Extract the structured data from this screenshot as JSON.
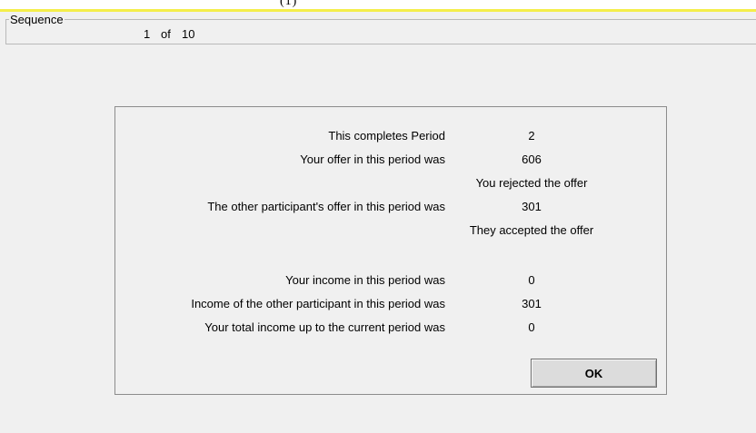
{
  "header": {
    "title_glyph": "(1)"
  },
  "sequence": {
    "label": "Sequence",
    "current": "1",
    "of_label": "of",
    "total": "10"
  },
  "results": {
    "period_label": "This completes Period",
    "period_value": "2",
    "your_offer_label": "Your offer in this period was",
    "your_offer_value": "606",
    "your_offer_status": "You rejected the offer",
    "other_offer_label": "The other participant's offer in this period was",
    "other_offer_value": "301",
    "other_offer_status": "They accepted the offer",
    "your_income_label": "Your income in this period was",
    "your_income_value": "0",
    "other_income_label": "Income of the other participant in this period was",
    "other_income_value": "301",
    "total_income_label": "Your total income up to the current period was",
    "total_income_value": "0"
  },
  "actions": {
    "ok_label": "OK"
  }
}
